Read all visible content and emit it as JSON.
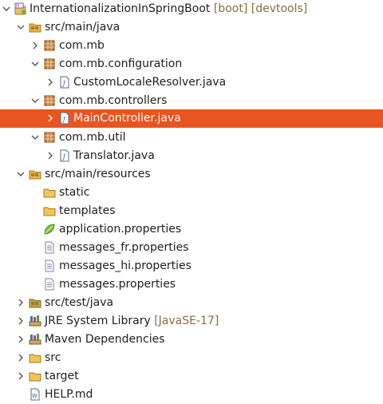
{
  "project": {
    "name": "InternationalizationInSpringBoot",
    "decoration": "[boot] [devtools]"
  },
  "tree": {
    "src_main_java": "src/main/java",
    "pkg_com_mb": "com.mb",
    "pkg_configuration": "com.mb.configuration",
    "file_custom_locale_resolver": "CustomLocaleResolver.java",
    "pkg_controllers": "com.mb.controllers",
    "file_main_controller": "MainController.java",
    "pkg_util": "com.mb.util",
    "file_translator": "Translator.java",
    "src_main_resources": "src/main/resources",
    "folder_static": "static",
    "folder_templates": "templates",
    "file_application_properties": "application.properties",
    "file_messages_fr": "messages_fr.properties",
    "file_messages_hi": "messages_hi.properties",
    "file_messages": "messages.properties",
    "src_test_java": "src/test/java",
    "jre_library": "JRE System Library",
    "jre_version": "[JavaSE-17]",
    "maven_dependencies": "Maven Dependencies",
    "folder_src": "src",
    "folder_target": "target",
    "file_help": "HELP.md"
  },
  "colors": {
    "selection": "#e95420",
    "decoration": "#8a6d3b"
  },
  "icons": {
    "project": "maven-boot-project-icon",
    "source_folder": "source-folder-icon",
    "package": "package-icon",
    "java_file": "java-file-icon",
    "folder": "folder-icon",
    "properties": "properties-file-icon",
    "library": "library-icon",
    "markdown": "markdown-file-icon"
  },
  "selected_item": "MainController.java"
}
